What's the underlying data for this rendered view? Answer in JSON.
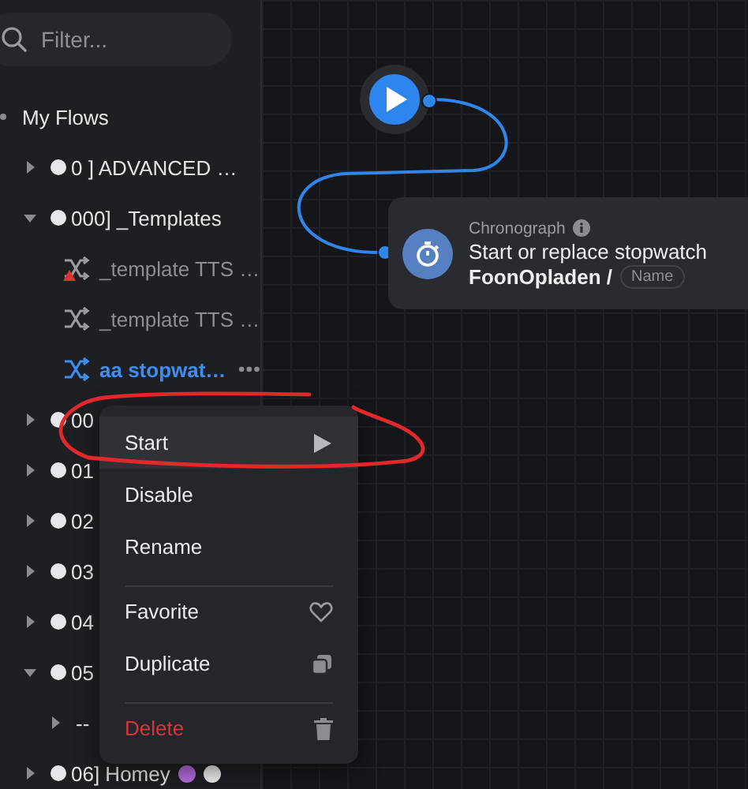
{
  "filter": {
    "placeholder": "Filter..."
  },
  "tree": {
    "label": "My Flows",
    "children": [
      {
        "kind": "folder",
        "label": "0 ] ADVANCED …",
        "expanded": false
      },
      {
        "kind": "folder",
        "label": "000] _Templates",
        "expanded": true,
        "children": [
          {
            "kind": "flow",
            "label": "_template TTS …",
            "warning": true,
            "disabled": true,
            "selected": false
          },
          {
            "kind": "flow",
            "label": "_template TTS …",
            "warning": false,
            "disabled": true,
            "selected": false
          },
          {
            "kind": "flow",
            "label": "aa stopwat…",
            "warning": false,
            "disabled": false,
            "selected": true
          }
        ]
      },
      {
        "kind": "folder",
        "label": "00",
        "expanded": false
      },
      {
        "kind": "folder",
        "label": "01",
        "expanded": false
      },
      {
        "kind": "folder",
        "label": "02",
        "expanded": false
      },
      {
        "kind": "folder",
        "label": "03",
        "expanded": false
      },
      {
        "kind": "folder",
        "label": "04",
        "expanded": false
      },
      {
        "kind": "folder",
        "label": "05",
        "expanded": true,
        "children": [
          {
            "kind": "folder",
            "label": "--",
            "expanded": false
          }
        ]
      },
      {
        "kind": "folder",
        "label": "06] Homey",
        "expanded": false,
        "badges": true
      }
    ]
  },
  "canvas": {
    "card": {
      "category": "Chronograph",
      "title": "Start or replace stopwatch",
      "argument": "FoonOpladen /",
      "chip": "Name"
    }
  },
  "context_menu": {
    "items": [
      {
        "label": "Start",
        "selected": true,
        "divider_before": false,
        "danger": false
      },
      {
        "label": "Disable",
        "selected": false,
        "divider_before": false,
        "danger": false
      },
      {
        "label": "Rename",
        "selected": false,
        "divider_before": false,
        "danger": false
      },
      {
        "label": "Favorite",
        "selected": false,
        "divider_before": true,
        "danger": false
      },
      {
        "label": "Duplicate",
        "selected": false,
        "divider_before": false,
        "danger": false
      },
      {
        "label": "Delete",
        "selected": false,
        "divider_before": true,
        "danger": true
      }
    ]
  }
}
